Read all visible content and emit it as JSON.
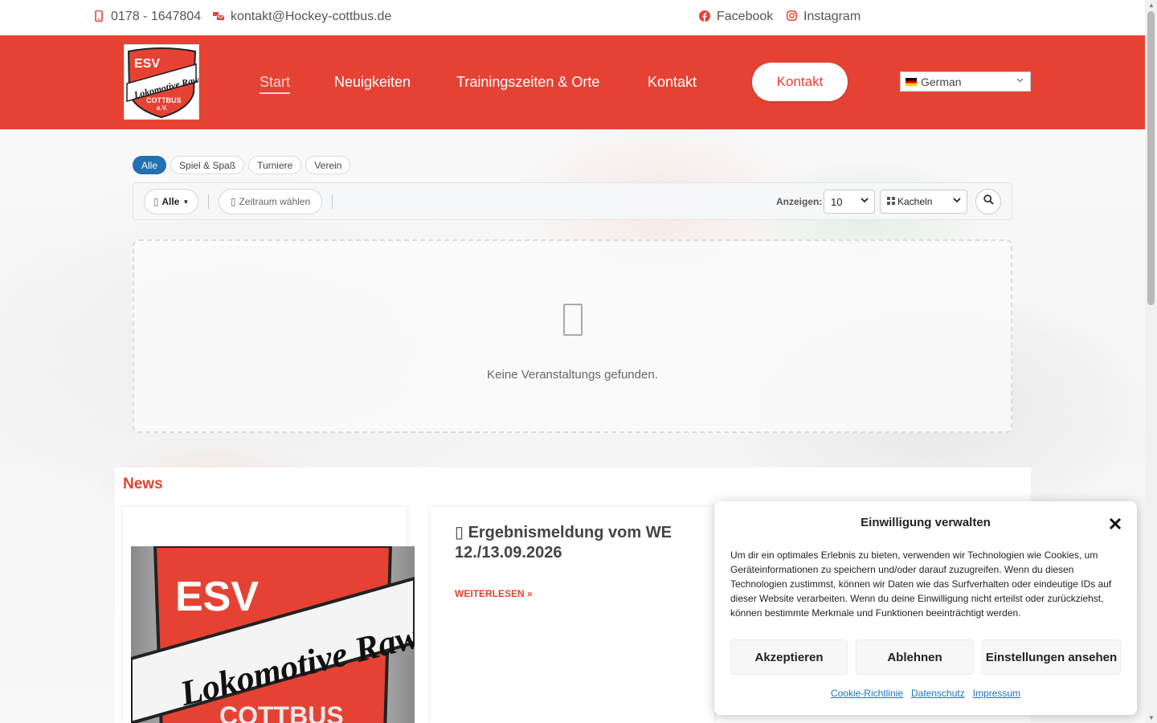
{
  "topbar": {
    "phone": "0178 - 1647804",
    "email": "kontakt@Hockey-cottbus.de",
    "facebook": "Facebook",
    "instagram": "Instagram"
  },
  "header": {
    "logo": {
      "line1": "ESV",
      "line2": "Lokomotive Raw",
      "line3": "COTTBUS",
      "line4": "e.V."
    },
    "nav": [
      "Start",
      "Neuigkeiten",
      "Trainingszeiten & Orte",
      "Kontakt"
    ],
    "cta": "Kontakt",
    "language": "German"
  },
  "events": {
    "categories": [
      "Alle",
      "Spiel & Spaß",
      "Turniere",
      "Verein"
    ],
    "all_filter": "Alle",
    "date_filter": "Zeitraum wählen",
    "show_label": "Anzeigen:",
    "per_page": "10",
    "view_mode": "Kacheln",
    "empty_text": "Keine Veranstaltungs gefunden."
  },
  "news": {
    "title": "News",
    "posts": [
      {
        "title": "Ergebnismeldung vom WE 12./13.09.2026",
        "read_more": "WEITERLESEN »"
      }
    ]
  },
  "cookie": {
    "title": "Einwilligung verwalten",
    "text": "Um dir ein optimales Erlebnis zu bieten, verwenden wir Technologien wie Cookies, um Geräteinformationen zu speichern und/oder darauf zuzugreifen. Wenn du diesen Technologien zustimmst, können wir Daten wie das Surfverhalten oder eindeutige IDs auf dieser Website verarbeiten. Wenn du deine Einwilligung nicht erteilst oder zurückziehst, können bestimmte Merkmale und Funktionen beeinträchtigt werden.",
    "accept": "Akzeptieren",
    "decline": "Ablehnen",
    "settings": "Einstellungen ansehen",
    "links": [
      "Cookie-Richtlinie",
      "Datenschutz",
      "Impressum"
    ]
  },
  "colors": {
    "brand_red": "#e64234",
    "link_blue": "#1e73be",
    "pill_active": "#2271b1"
  }
}
